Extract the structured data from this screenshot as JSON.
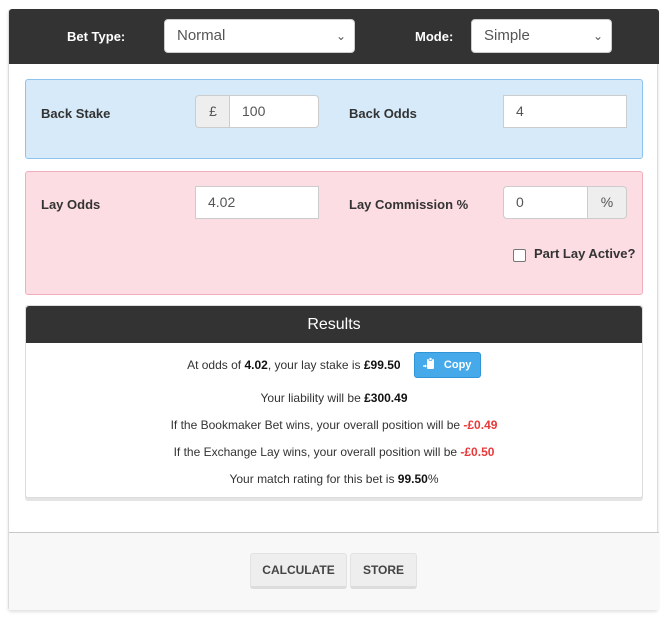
{
  "header": {
    "bet_type_label": "Bet Type:",
    "bet_type_value": "Normal",
    "mode_label": "Mode:",
    "mode_value": "Simple"
  },
  "back_panel": {
    "back_stake_label": "Back Stake",
    "currency_symbol": "£",
    "back_stake_value": "100",
    "back_odds_label": "Back Odds",
    "back_odds_value": "4"
  },
  "lay_panel": {
    "lay_odds_label": "Lay Odds",
    "lay_odds_value": "4.02",
    "lay_commission_label": "Lay Commission %",
    "lay_commission_value": "0",
    "percent_symbol": "%",
    "part_lay_label": "Part Lay Active?",
    "part_lay_checked": false
  },
  "results": {
    "title": "Results",
    "line1_prefix": "At odds of ",
    "line1_odds": "4.02",
    "line1_mid": ", your lay stake is ",
    "line1_stake": "£99.50",
    "copy_label": "Copy",
    "line2_prefix": "Your liability will be ",
    "line2_value": "£300.49",
    "line3_prefix": "If the Bookmaker Bet wins, your overall position will be ",
    "line3_value": "-£0.49",
    "line4_prefix": "If the Exchange Lay wins, your overall position will be ",
    "line4_value": "-£0.50",
    "line5_prefix": "Your match rating for this bet is ",
    "line5_value": "99.50",
    "line5_suffix": "%"
  },
  "footer": {
    "calculate_label": "CALCULATE",
    "store_label": "STORE"
  },
  "colors": {
    "header_bg": "#333333",
    "back_panel_bg": "#d6eaf9",
    "lay_panel_bg": "#fcdde3",
    "negative": "#e8393a",
    "copy_button": "#46a9ea"
  }
}
